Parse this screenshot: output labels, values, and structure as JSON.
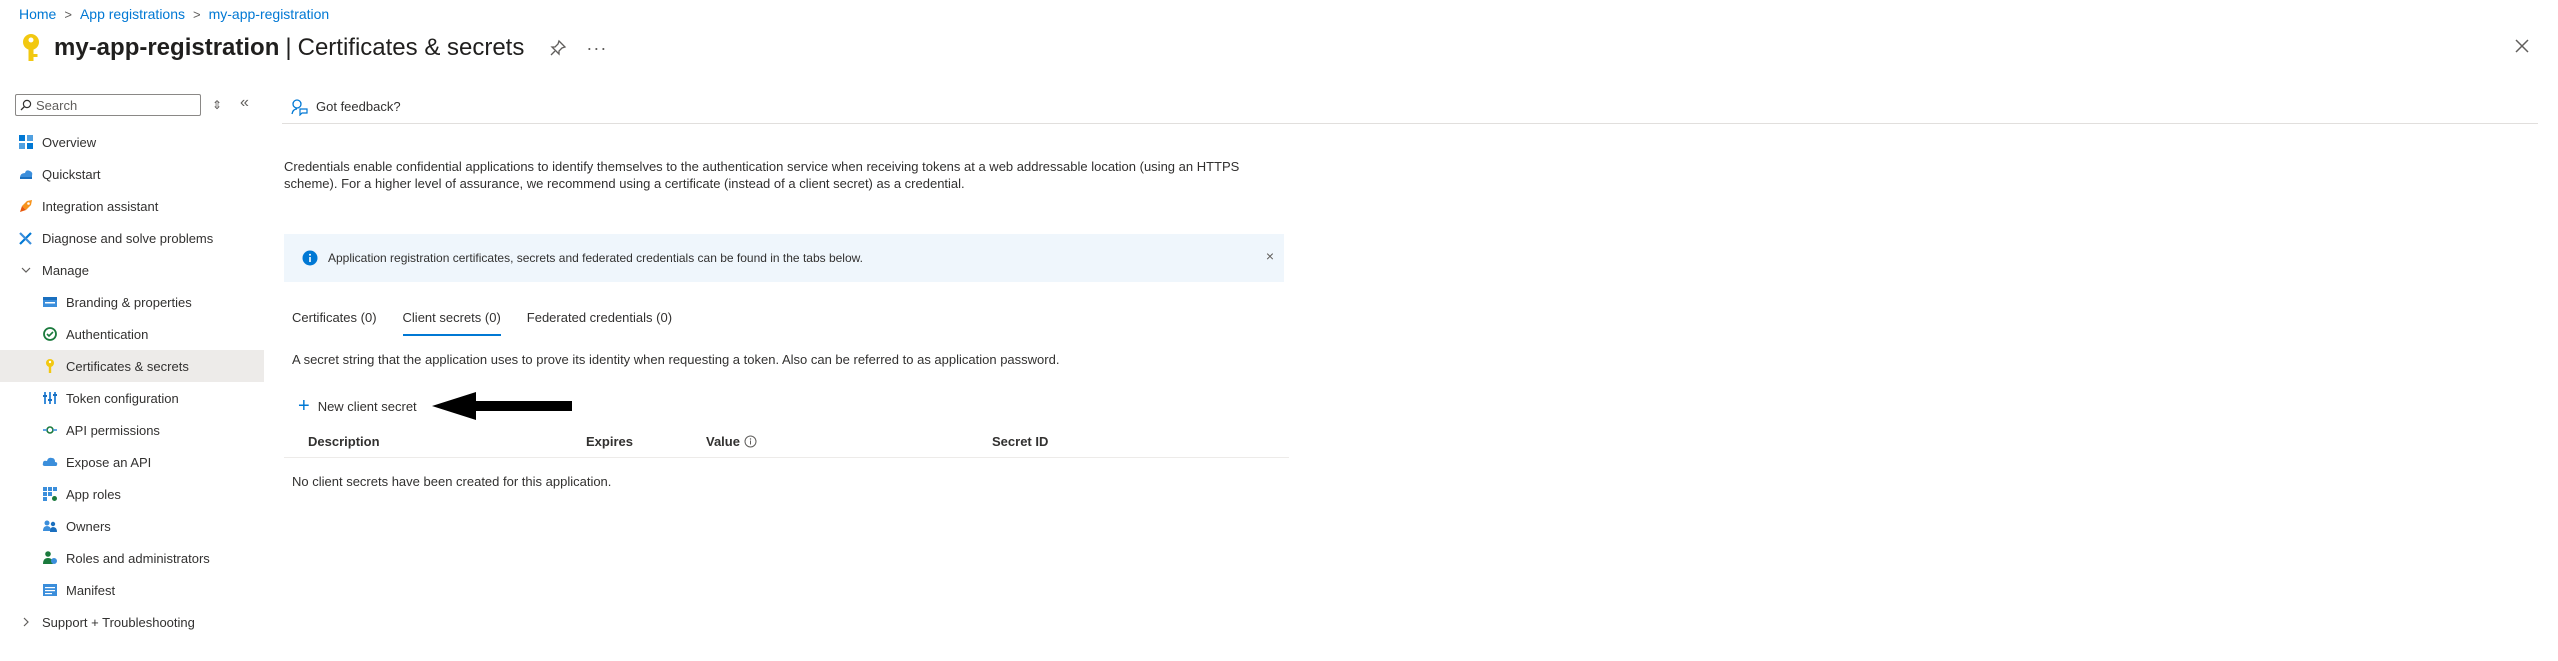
{
  "breadcrumb": {
    "items": [
      "Home",
      "App registrations",
      "my-app-registration"
    ],
    "separator": ">"
  },
  "header": {
    "title": "my-app-registration",
    "subtitle": "Certificates & secrets",
    "separator": "|",
    "more": "···"
  },
  "sidebar": {
    "search_placeholder": "Search",
    "sort_glyph": "⇕",
    "collapse_glyph": "«",
    "items": [
      {
        "label": "Overview",
        "icon": "overview-icon"
      },
      {
        "label": "Quickstart",
        "icon": "quickstart-icon"
      },
      {
        "label": "Integration assistant",
        "icon": "rocket-icon"
      },
      {
        "label": "Diagnose and solve problems",
        "icon": "wrench-icon"
      },
      {
        "label": "Manage",
        "icon": "chevron-down-icon"
      },
      {
        "label": "Branding & properties",
        "icon": "branding-icon"
      },
      {
        "label": "Authentication",
        "icon": "authentication-icon"
      },
      {
        "label": "Certificates & secrets",
        "icon": "key-icon",
        "active": true
      },
      {
        "label": "Token configuration",
        "icon": "token-icon"
      },
      {
        "label": "API permissions",
        "icon": "api-permissions-icon"
      },
      {
        "label": "Expose an API",
        "icon": "cloud-icon"
      },
      {
        "label": "App roles",
        "icon": "app-roles-icon"
      },
      {
        "label": "Owners",
        "icon": "owners-icon"
      },
      {
        "label": "Roles and administrators",
        "icon": "roles-icon"
      },
      {
        "label": "Manifest",
        "icon": "manifest-icon"
      },
      {
        "label": "Support + Troubleshooting",
        "icon": "chevron-right-icon"
      }
    ]
  },
  "cmdbar": {
    "feedback_label": "Got feedback?"
  },
  "main": {
    "description": "Credentials enable confidential applications to identify themselves to the authentication service when receiving tokens at a web addressable location (using an HTTPS scheme). For a higher level of assurance, we recommend using a certificate (instead of a client secret) as a credential.",
    "banner_text": "Application registration certificates, secrets and federated credentials can be found in the tabs below.",
    "banner_close": "×",
    "tabs": [
      {
        "label": "Certificates (0)",
        "active": false
      },
      {
        "label": "Client secrets (0)",
        "active": true
      },
      {
        "label": "Federated credentials (0)",
        "active": false
      }
    ],
    "tab_description": "A secret string that the application uses to prove its identity when requesting a token. Also can be referred to as application password.",
    "new_secret_label": "New client secret",
    "plus_glyph": "+",
    "columns": [
      "Description",
      "Expires",
      "Value",
      "Secret ID"
    ],
    "empty_message": "No client secrets have been created for this application."
  },
  "colors": {
    "accent": "#0078d4",
    "banner_bg": "#eff6fc",
    "active_nav_bg": "#edebe9",
    "key_yellow": "#f2c811"
  }
}
